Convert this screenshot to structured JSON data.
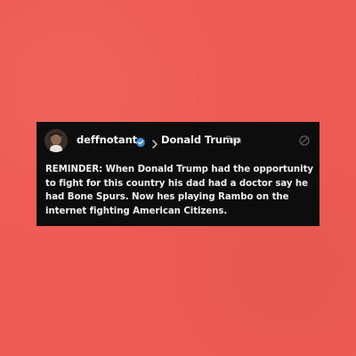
{
  "post": {
    "author": "deffnotant",
    "reply_to": "Donald Trump",
    "time": "3m",
    "text": "REMINDER: When Donald Trump had the opportunity to fight for this country his dad had a doctor say he had Bone Spurs. Now hes playing Rambo on the internet fighting American Citizens."
  },
  "icons": {
    "verified": "verified-badge-icon",
    "reply_chevron": "chevron-right-icon",
    "mute": "mute-icon"
  },
  "colors": {
    "background": "#ee5b54",
    "card": "#0d0d0e",
    "verified": "#3b8fd8",
    "timestamp": "#7d7d7d"
  }
}
